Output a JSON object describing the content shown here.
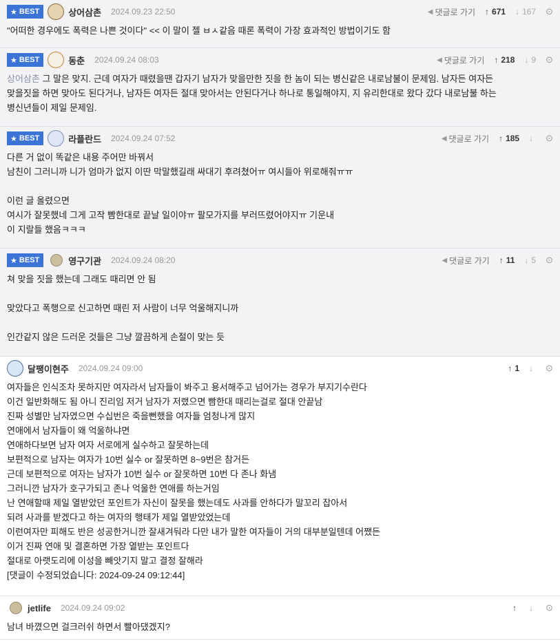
{
  "comments": [
    {
      "best": true,
      "badge": "BEST",
      "nick": "상어삼촌",
      "date": "2024.09.23 22:50",
      "reply_label": "댓글로 가기",
      "up": "671",
      "down": "167",
      "quote": "",
      "lines": [
        "\"어떠한 경우에도 폭력은 나쁜 것이다\" << 이 말이 젤 ㅂㅅ같음 때론 폭력이 가장 효과적인 방법이기도 함"
      ]
    },
    {
      "best": true,
      "badge": "BEST",
      "nick": "동춘",
      "date": "2024.09.24 08:03",
      "reply_label": "댓글로 가기",
      "up": "218",
      "down": "9",
      "quote": "상어삼촌",
      "lines": [
        " 그 말은 맞지. 근데 여자가 때렸을땐 갑자기 남자가 맞을만한 짓을 한 놈이 되는 병신같은 내로남불이 문제임. 남자든 여자든",
        "맞을짓을 하면 맞아도 된다거나, 남자든 여자든 절대 맞아서는 안된다거나 하나로 통일해야지, 지 유리한대로 왔다 갔다 내로남불 하는",
        "병신년들이 제일 문제임."
      ]
    },
    {
      "best": true,
      "badge": "BEST",
      "nick": "라플란드",
      "date": "2024.09.24 07:52",
      "reply_label": "댓글로 가기",
      "up": "185",
      "down": "",
      "quote": "",
      "lines": [
        "다른 거 없이 똑같은 내용 주어만 바꿔서",
        "남친이 그러니까 니가 엄마가 없지 이딴 막말했길래 싸대기 후려쳤어ㅠ 여시들아 위로해줘ㅠㅠ",
        "",
        "이런 글 올렸으면",
        "여시가 잘못했네 그게 고작 빰한대로 끝날 일이야ㅠ 팔모가지를 부러뜨렸어야지ㅠ 기운내",
        "이 지랄들 했음ㅋㅋㅋ"
      ]
    },
    {
      "best": true,
      "badge": "BEST",
      "nick": "영구기관",
      "date": "2024.09.24 08:20",
      "reply_label": "댓글로 가기",
      "up": "11",
      "down": "5",
      "quote": "",
      "lines": [
        "쳐 맞을 짓을 했는데 그래도 때리면 안 됨",
        "",
        "맞았다고 폭행으로 신고하면 때린 저 사람이 너무 억울해지니까",
        "",
        "인간같지 않은 드러운 것들은 그냥 깔끔하게 손절이 맞는 듯"
      ]
    },
    {
      "best": false,
      "badge": "",
      "nick": "달팽이현주",
      "date": "2024.09.24 09:00",
      "reply_label": "",
      "up": "1",
      "down": "",
      "quote": "",
      "lines": [
        "여자들은 인식조차 못하지만 여자라서 남자들이 봐주고 용서해주고 넘어가는 경우가 부지기수란다",
        "이건 일반화해도 됨 아니 진리임 저거 남자가 저랬으면 빰한대 때리는걸로 절대 안끝남",
        "진짜 성별만 남자였으면 수십번은 죽을뻔했을 여자들 엄청나게 많지",
        "연애에서 남자들이 왜 억울하냐면",
        "연애하다보면 남자 여자 서로에게 실수하고 잘못하는데",
        "보편적으로 남자는 여자가 10번 실수 or 잘못하면 8~9번은 참거든",
        "근데 보편적으로 여자는 남자가 10번 실수 or 잘못하면 10번 다 존나 화냄",
        "그러니깐 남자가 호구가되고 존나 억울한 연애를 하는거임",
        "난 연애할때 제일 열받았던 포인트가 자신이 잘못을 했는데도 사과를 안하다가 말꼬리 잡아서",
        "되려 사과를 받겠다고 하는 여자의 행태가 제일 열받았었는데",
        "이런여자만 피해도 반은 성공한거니깐 잘새겨둬라 다만 내가 말한 여자들이 거의 대부분일텐데 어쨌든",
        "이거 진짜 연애 및 결혼하면 가장 열받는 포인트다",
        "절대로 아랫도리에 이성을 빼앗기지 말고 결정 잘해라",
        "[댓글이 수정되었습니다: 2024-09-24 09:12:44]"
      ]
    },
    {
      "best": false,
      "badge": "",
      "nick": "jetlife",
      "date": "2024.09.24 09:02",
      "reply_label": "",
      "up": "",
      "down": "",
      "quote": "",
      "lines": [
        "남녀 바꼈으면 걸크러쉬 하면서 빨아댔겠지?"
      ]
    }
  ],
  "icons": {
    "reply": "reply-arrow-icon",
    "up": "thumbs-up-icon",
    "down": "thumbs-down-icon",
    "link": "link-icon",
    "star": "star-icon"
  },
  "colors": {
    "badge": "#3b73d6",
    "best_bg": "#f3f3f5",
    "quote": "#8a8fa3"
  }
}
